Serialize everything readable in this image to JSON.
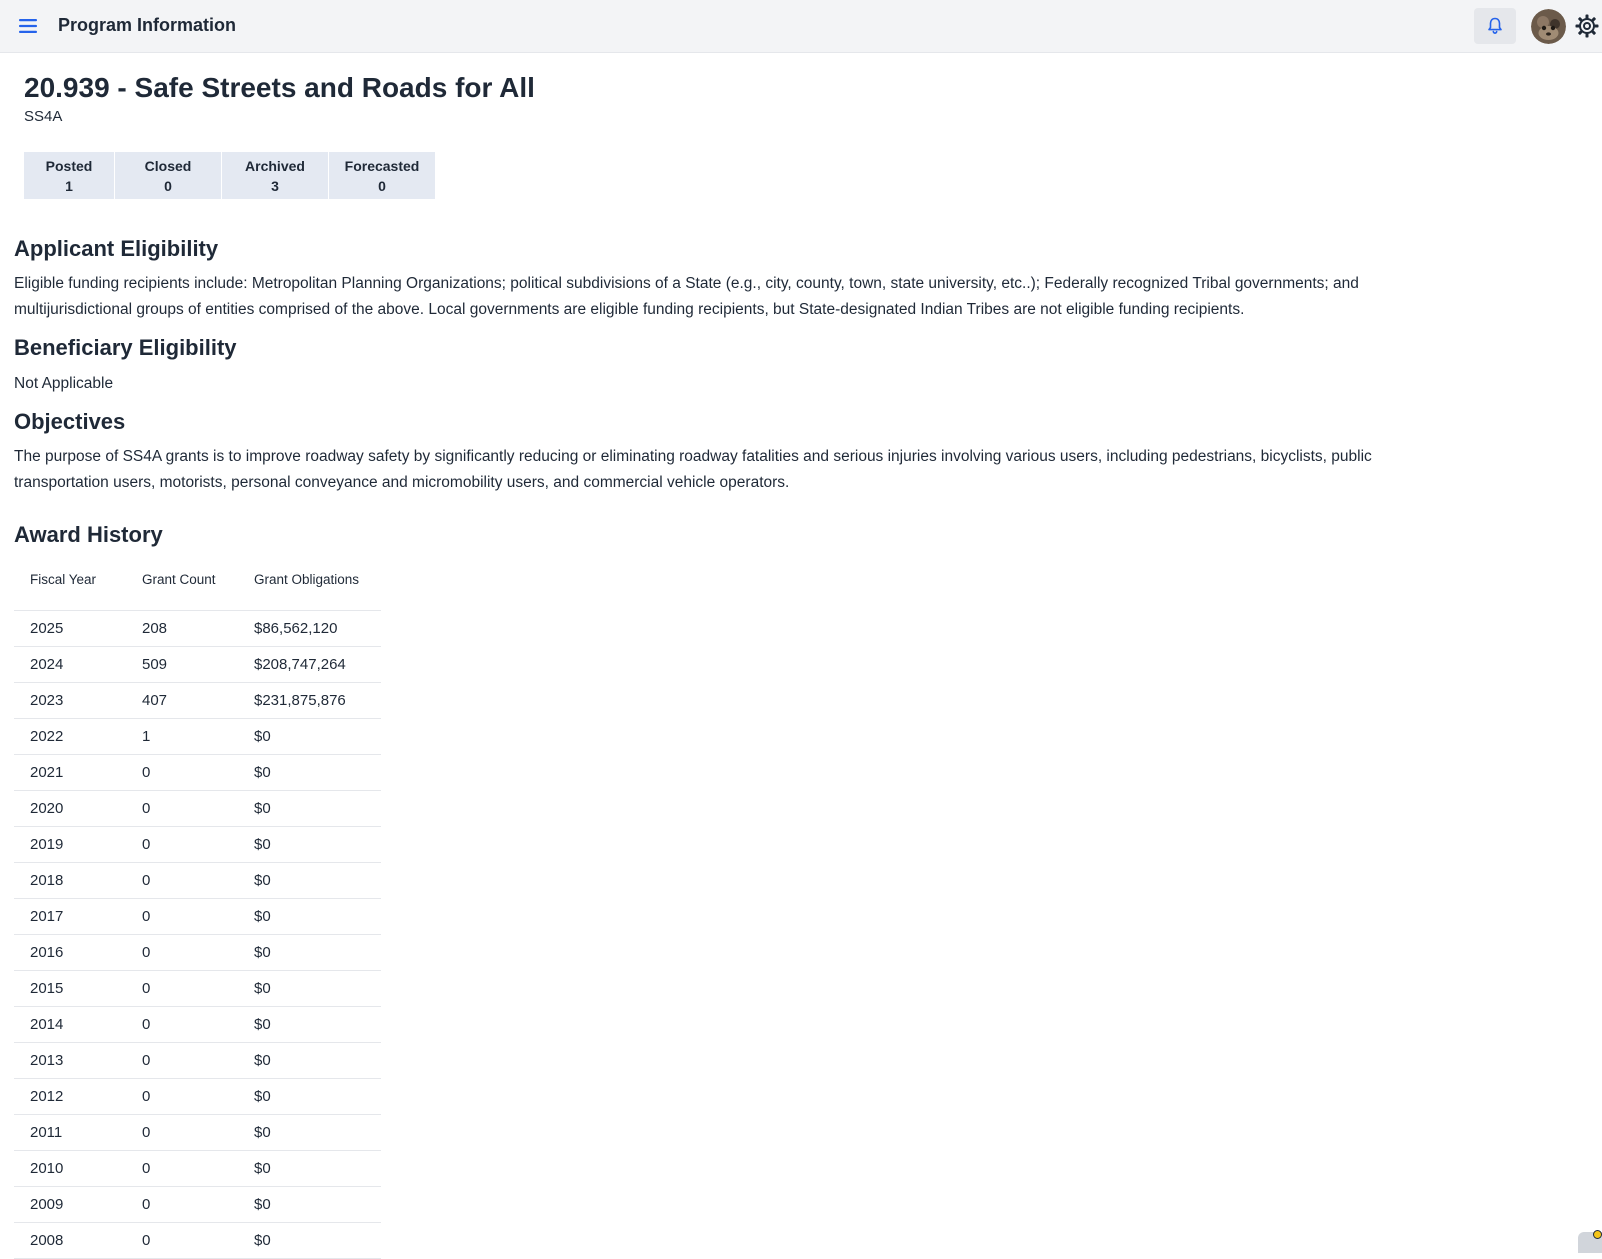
{
  "header": {
    "title": "Program Information",
    "menu_icon": "hamburger-menu-icon",
    "bell_icon": "bell-icon",
    "settings_icon": "gear-icon",
    "accent_color": "#2563eb"
  },
  "program": {
    "title": "20.939 - Safe Streets and Roads for All",
    "acronym": "SS4A"
  },
  "status_counts": [
    {
      "label": "Posted",
      "value": "1"
    },
    {
      "label": "Closed",
      "value": "0"
    },
    {
      "label": "Archived",
      "value": "3"
    },
    {
      "label": "Forecasted",
      "value": "0"
    }
  ],
  "sections": {
    "applicant_eligibility": {
      "heading": "Applicant Eligibility",
      "text": "Eligible funding recipients include: Metropolitan Planning Organizations; political subdivisions of a State (e.g., city, county, town, state university, etc..); Federally recognized Tribal governments; and multijurisdictional groups of entities comprised of the above. Local governments are eligible funding recipients, but State-designated Indian Tribes are not eligible funding recipients."
    },
    "beneficiary_eligibility": {
      "heading": "Beneficiary Eligibility",
      "text": "Not Applicable"
    },
    "objectives": {
      "heading": "Objectives",
      "text": "The purpose of SS4A grants is to improve roadway safety by significantly reducing or eliminating roadway fatalities and serious injuries involving various users, including pedestrians, bicyclists, public transportation users, motorists, personal conveyance and micromobility users, and commercial vehicle operators."
    }
  },
  "award_history": {
    "heading": "Award History",
    "columns": [
      "Fiscal Year",
      "Grant Count",
      "Grant Obligations"
    ],
    "rows": [
      [
        "2025",
        "208",
        "$86,562,120"
      ],
      [
        "2024",
        "509",
        "$208,747,264"
      ],
      [
        "2023",
        "407",
        "$231,875,876"
      ],
      [
        "2022",
        "1",
        "$0"
      ],
      [
        "2021",
        "0",
        "$0"
      ],
      [
        "2020",
        "0",
        "$0"
      ],
      [
        "2019",
        "0",
        "$0"
      ],
      [
        "2018",
        "0",
        "$0"
      ],
      [
        "2017",
        "0",
        "$0"
      ],
      [
        "2016",
        "0",
        "$0"
      ],
      [
        "2015",
        "0",
        "$0"
      ],
      [
        "2014",
        "0",
        "$0"
      ],
      [
        "2013",
        "0",
        "$0"
      ],
      [
        "2012",
        "0",
        "$0"
      ],
      [
        "2011",
        "0",
        "$0"
      ],
      [
        "2010",
        "0",
        "$0"
      ],
      [
        "2009",
        "0",
        "$0"
      ],
      [
        "2008",
        "0",
        "$0"
      ]
    ]
  }
}
